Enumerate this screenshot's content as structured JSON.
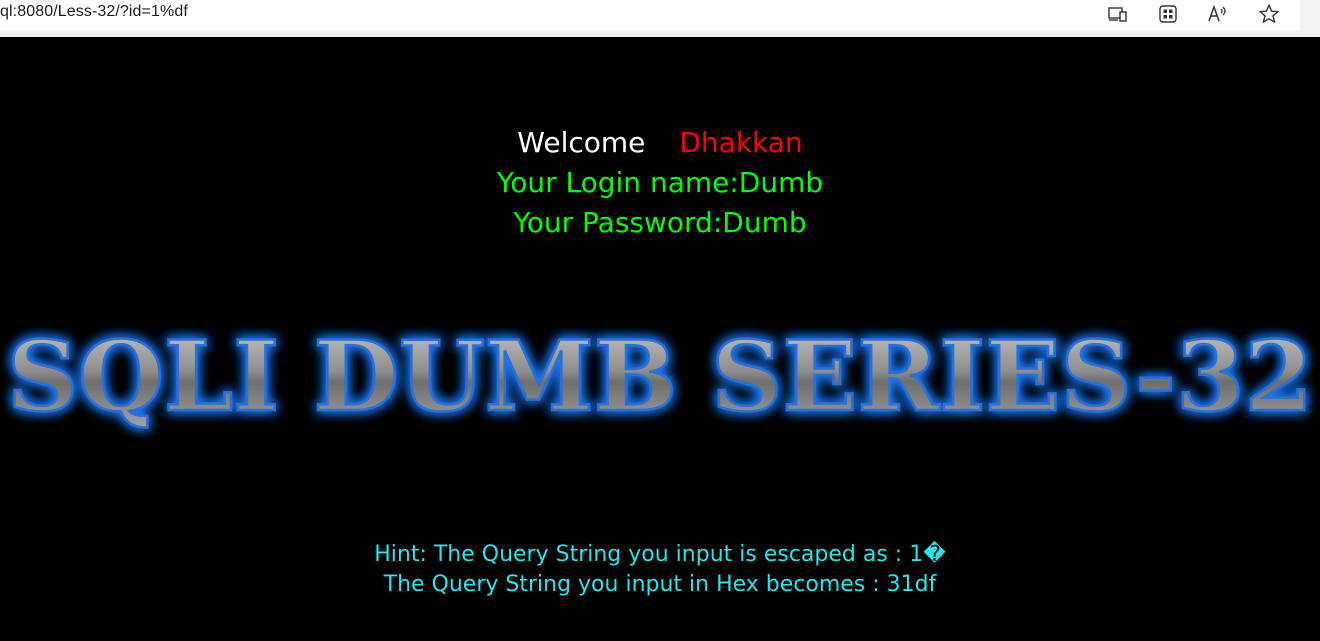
{
  "browser": {
    "url": "ql:8080/Less-32/?id=1%df",
    "icons": [
      "reading-mode-icon",
      "apps-icon",
      "read-aloud-icon",
      "favorite-star-icon"
    ]
  },
  "page": {
    "welcome_label": "Welcome",
    "welcome_user": "Dhakkan",
    "login_line": "Your Login name:Dumb",
    "password_line": "Your Password:Dumb",
    "banner_text": "SQLI DUMB SERIES-32",
    "hint_escaped": "Hint: The Query String you input is escaped as : 1�",
    "hint_hex": "The Query String you input in Hex becomes : 31df"
  },
  "colors": {
    "background": "#000000",
    "welcome": "#ffffff",
    "user": "#ff0000",
    "credentials": "#00ff00",
    "hint": "#26e6ec",
    "banner_glow": "#1e7bff"
  }
}
